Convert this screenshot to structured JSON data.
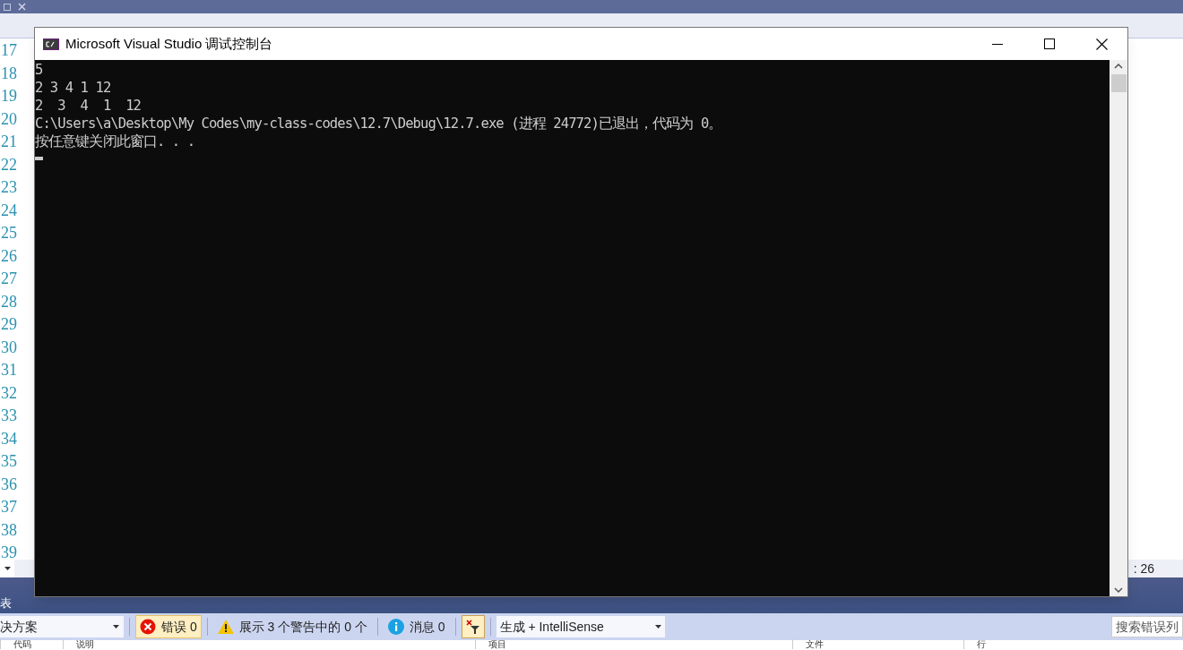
{
  "editor": {
    "line_numbers": [
      "17",
      "18",
      "19",
      "20",
      "21",
      "22",
      "23",
      "24",
      "25",
      "26",
      "27",
      "28",
      "29",
      "30",
      "31",
      "32",
      "33",
      "34",
      "35",
      "36",
      "37",
      "38",
      "39"
    ],
    "position": ": 26"
  },
  "panel": {
    "title": "表",
    "scope": "决方案",
    "errors": {
      "label": "错误 0",
      "selected": true
    },
    "warnings": {
      "label": "展示 3 个警告中的 0 个",
      "selected": false
    },
    "messages": {
      "label": "消息 0",
      "selected": false
    },
    "build_filter": "生成 + IntelliSense",
    "search": {
      "placeholder": "搜索错误列"
    },
    "columns": [
      "代码",
      "说明",
      "项目",
      "文件",
      "行"
    ]
  },
  "console": {
    "title": "Microsoft Visual Studio 调试控制台",
    "lines": [
      "5",
      "2 3 4 1 12",
      "2  3  4  1  12",
      "C:\\Users\\a\\Desktop\\My Codes\\my-class-codes\\12.7\\Debug\\12.7.exe (进程 24772)已退出，代码为 0。",
      "按任意键关闭此窗口. . ."
    ]
  }
}
